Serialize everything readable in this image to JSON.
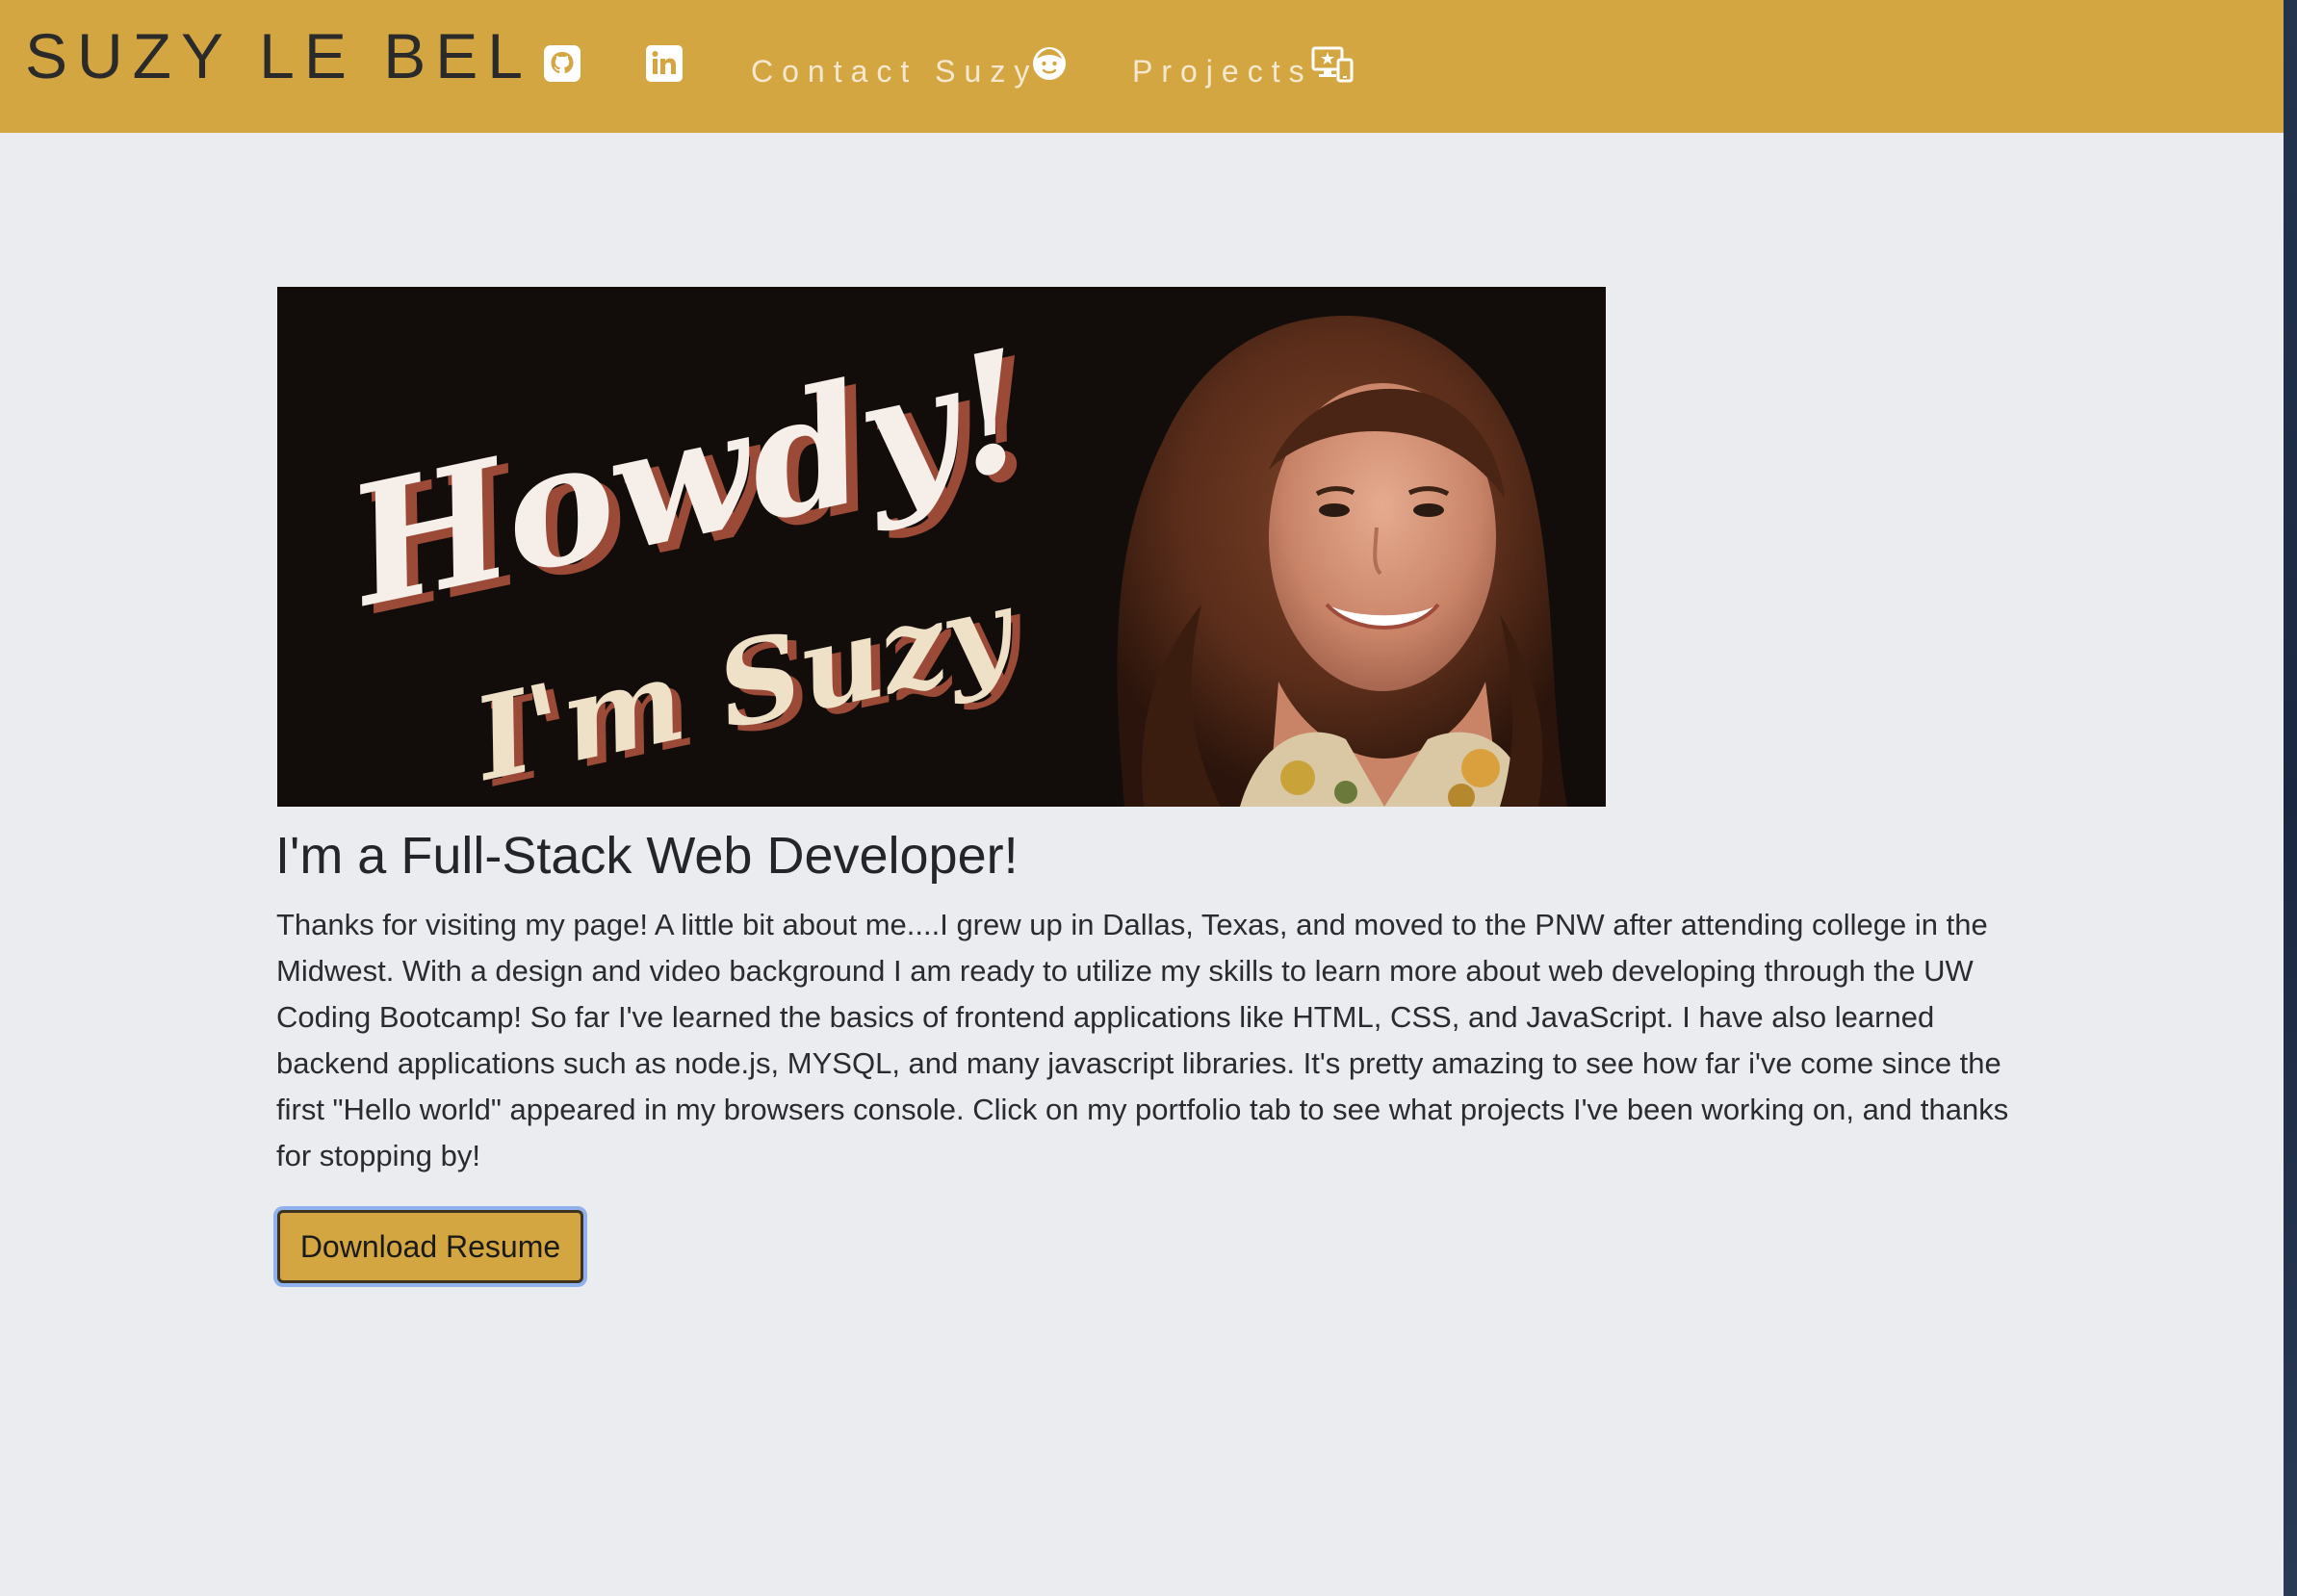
{
  "navbar": {
    "brand": "SUZY LE BEL",
    "github_icon": "github-icon",
    "linkedin_icon": "linkedin-icon",
    "contact_label": "Contact Suzy",
    "contact_icon": "smiley-face-icon",
    "projects_label": "Projects",
    "projects_icon": "devices-star-icon"
  },
  "hero": {
    "banner_line1": "Howdy!",
    "banner_line2": "I'm Suzy"
  },
  "main": {
    "headline": "I'm a Full-Stack Web Developer!",
    "about": "Thanks for visiting my page! A little bit about me....I grew up in Dallas, Texas, and moved to the PNW after attending college in the Midwest. With a design and video background I am ready to utilize my skills to learn more about web developing through the UW Coding Bootcamp! So far I've learned the basics of frontend applications like HTML, CSS, and JavaScript. I have also learned backend applications such as node.js, MYSQL, and many javascript libraries. It's pretty amazing to see how far i've come since the first \"Hello world\" appeared in my browsers console. Click on my portfolio tab to see what projects I've been working on, and thanks for stopping by!",
    "resume_button": "Download Resume"
  },
  "colors": {
    "navbar_bg": "#d4a641",
    "page_bg": "#ebecf0",
    "button_bg": "#d4a641",
    "focus_ring": "#8fb1ee"
  }
}
